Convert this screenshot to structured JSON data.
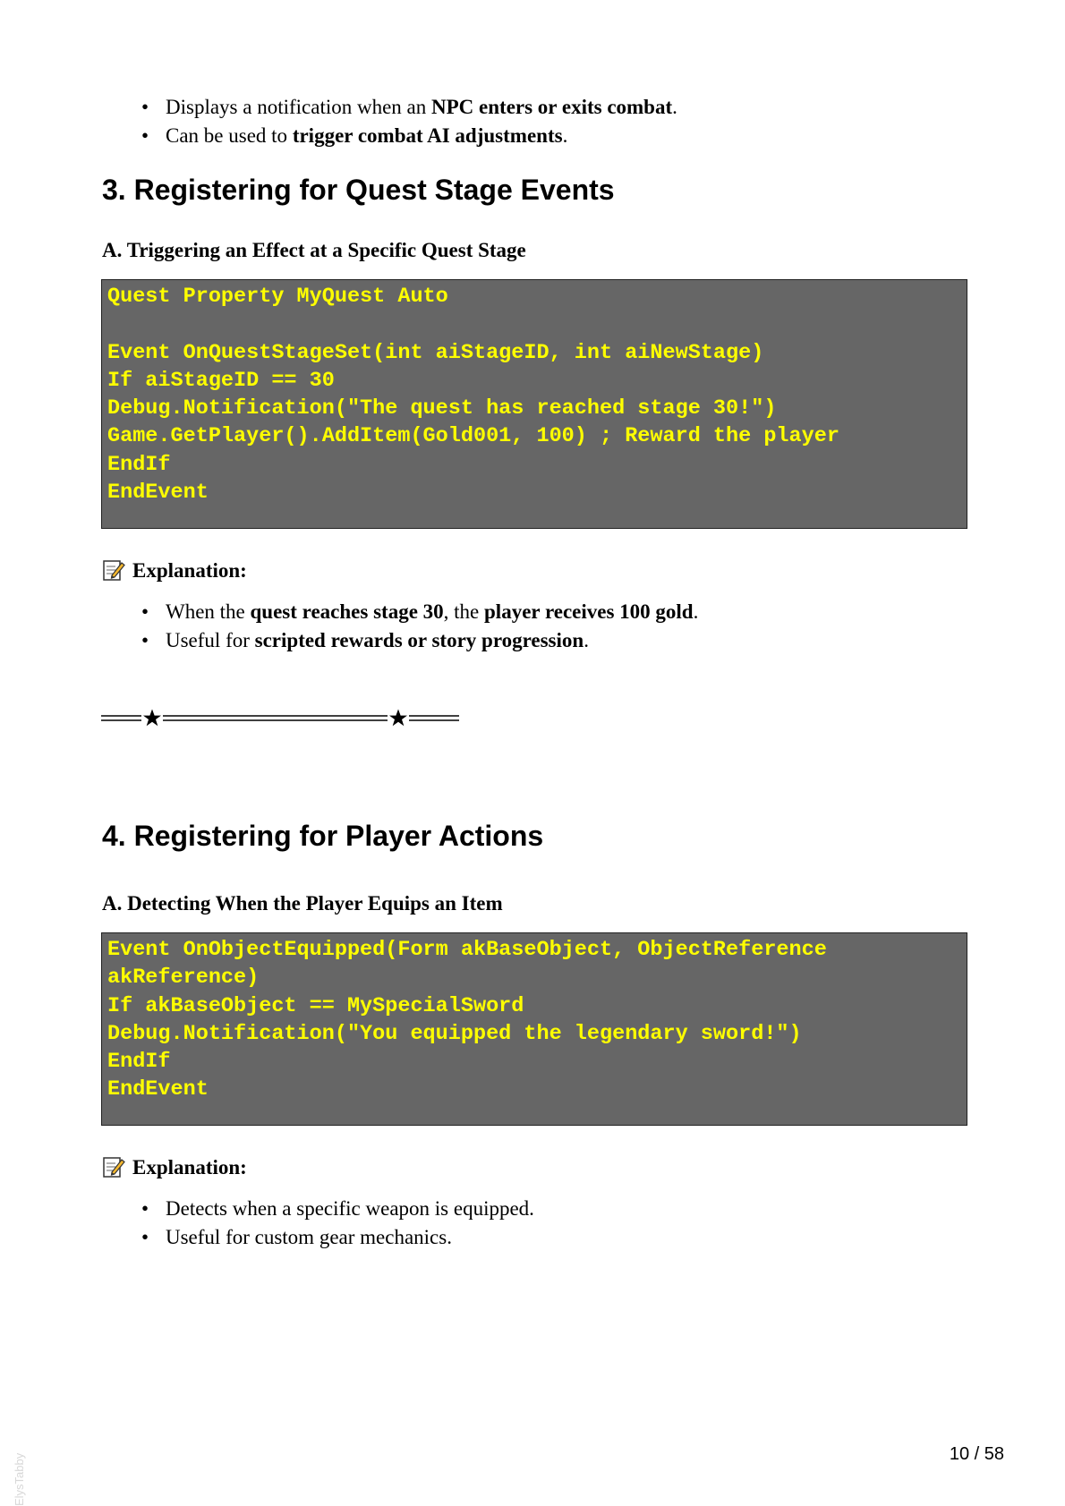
{
  "top_bullets": [
    {
      "pre": "Displays a notification when an ",
      "bold": "NPC enters or exits combat",
      "post": "."
    },
    {
      "pre": "Can be used to ",
      "bold": "trigger combat AI adjustments",
      "post": "."
    }
  ],
  "section3": {
    "title": "3. Registering for Quest Stage Events",
    "subtitle": "A. Triggering an Effect at a Specific Quest Stage",
    "code": [
      "Quest Property MyQuest Auto",
      "",
      "Event OnQuestStageSet(int aiStageID, int aiNewStage)",
      "If aiStageID == 30",
      "Debug.Notification(\"The quest has reached stage 30!\")",
      "Game.GetPlayer().AddItem(Gold001, 100) ; Reward the player",
      "EndIf",
      "EndEvent"
    ],
    "explanation_label": "Explanation:",
    "bullets": [
      {
        "t1": "When the ",
        "b1": "quest reaches stage 30",
        "t2": ", the ",
        "b2": "player receives 100 gold",
        "t3": "."
      },
      {
        "t1": "Useful for ",
        "b1": "scripted rewards or story progression",
        "t2": ".",
        "b2": "",
        "t3": ""
      }
    ]
  },
  "divider_icon": "star-divider",
  "section4": {
    "title": "4. Registering for Player Actions",
    "subtitle": "A. Detecting When the Player Equips an Item",
    "code": [
      "Event OnObjectEquipped(Form akBaseObject, ObjectReference",
      "akReference)",
      "If akBaseObject == MySpecialSword",
      "Debug.Notification(\"You equipped the legendary sword!\")",
      "EndIf",
      "EndEvent"
    ],
    "explanation_label": "Explanation:",
    "bullets": [
      "Detects when a specific weapon is equipped.",
      "Useful for custom gear mechanics."
    ]
  },
  "footer": {
    "page_number": "10 / 58",
    "watermark": "ElysTabby"
  },
  "colors": {
    "code_background": "#666666",
    "code_text": "#ffff00"
  },
  "icons": {
    "explanation": "memo-icon",
    "bullet": "bullet-dot"
  }
}
